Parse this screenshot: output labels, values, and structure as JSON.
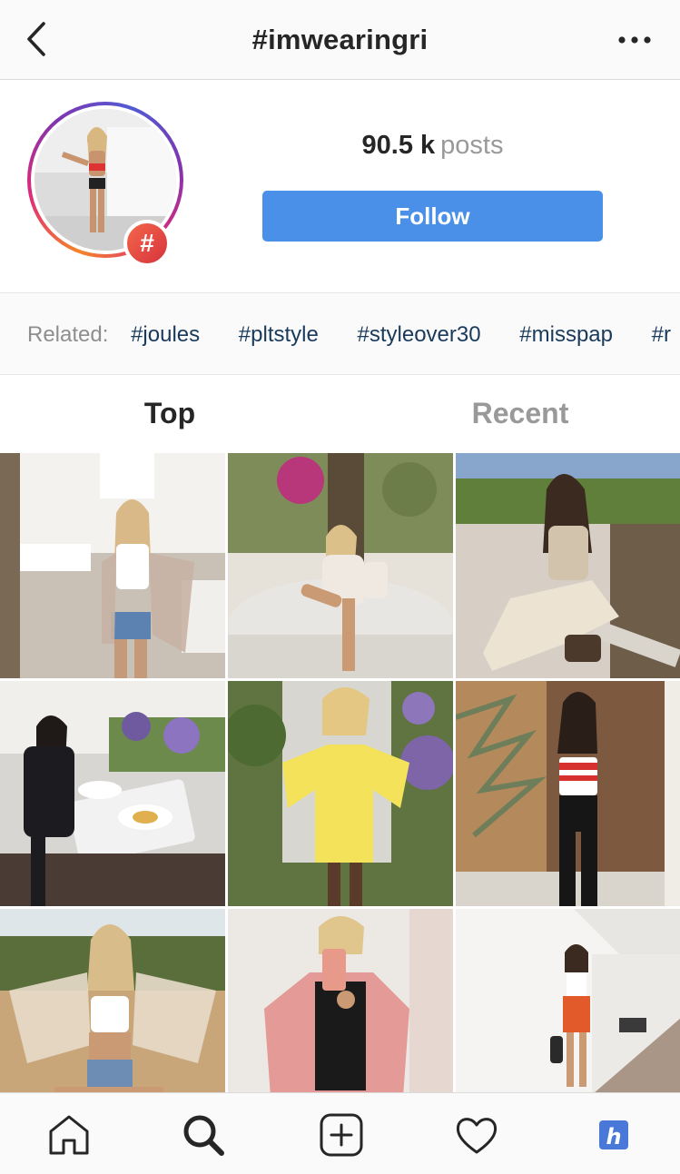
{
  "header": {
    "title": "#imwearingri",
    "back_icon": "chevron-left-icon",
    "more_icon": "ellipsis-icon"
  },
  "profile": {
    "post_count": "90.5 k",
    "post_label": "posts",
    "follow_label": "Follow",
    "badge_symbol": "#"
  },
  "related": {
    "label": "Related:",
    "tags": [
      "#joules",
      "#pltstyle",
      "#styleover30",
      "#misspap",
      "#r"
    ]
  },
  "tabs": {
    "top": "Top",
    "recent": "Recent"
  },
  "grid": {
    "photos": [
      "photo-1",
      "photo-2",
      "photo-3",
      "photo-4",
      "photo-5",
      "photo-6",
      "photo-7",
      "photo-8",
      "photo-9"
    ]
  },
  "nav": {
    "home_icon": "home-icon",
    "search_icon": "search-icon",
    "add_icon": "plus-square-icon",
    "activity_icon": "heart-icon",
    "profile_icon": "profile-badge-icon",
    "profile_badge_letter": "h"
  },
  "colors": {
    "follow_blue": "#4a90e8",
    "badge_red": "#e0483f",
    "tag_text": "#1a3a5c"
  }
}
